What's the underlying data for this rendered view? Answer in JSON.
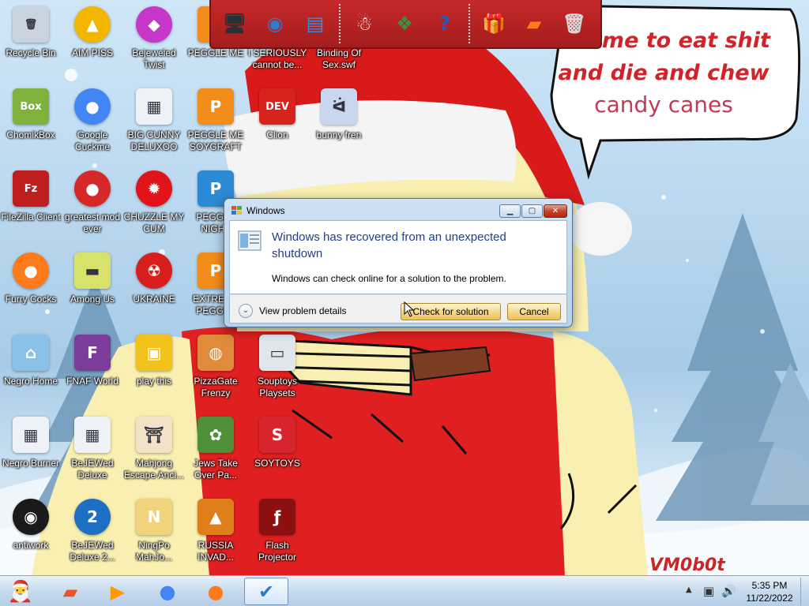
{
  "desktop_icons": [
    {
      "label": "Recycle Bin",
      "icon": "recycle-bin-icon",
      "color": "#c9d3de",
      "glyph": "🗑"
    },
    {
      "label": "AIM PISS",
      "icon": "aim-icon",
      "color": "#f2b600",
      "glyph": "▲"
    },
    {
      "label": "Bejeweled Twist",
      "icon": "bejeweled-icon",
      "color": "#c437c9",
      "glyph": "◆"
    },
    {
      "label": "PEGGLE ME",
      "icon": "peggle-icon",
      "color": "#f28c1b",
      "glyph": "P"
    },
    {
      "label": "I SERIOUSLY cannot be...",
      "icon": "globe-icon",
      "color": "#2a8fd6",
      "glyph": "◉"
    },
    {
      "label": "Binding Of Sex.swf",
      "icon": "swf-file-icon",
      "color": "#e8e8e8",
      "glyph": "▦"
    },
    {
      "label": "ChomikBox",
      "icon": "chomikbox-icon",
      "color": "#7fb23a",
      "glyph": "Box"
    },
    {
      "label": "Google Cuckme",
      "icon": "chrome-icon",
      "color": "#4285f4",
      "glyph": "●"
    },
    {
      "label": "BIG CUNNY DELUXOO",
      "icon": "document-icon",
      "color": "#eef2f7",
      "glyph": "▦"
    },
    {
      "label": "PEGGLE ME SOYGRAFT",
      "icon": "peggle-icon",
      "color": "#f28c1b",
      "glyph": "P"
    },
    {
      "label": "Clion",
      "icon": "devcpp-icon",
      "color": "#d8221c",
      "glyph": "DEV"
    },
    {
      "label": "bunny fren",
      "icon": "bunny-icon",
      "color": "#c8d6f0",
      "glyph": "ᐛ"
    },
    {
      "label": "FileZilla Client",
      "icon": "filezilla-icon",
      "color": "#bf1e1e",
      "glyph": "Fz"
    },
    {
      "label": "greatest mod ever",
      "icon": "angry-bird-icon",
      "color": "#d62828",
      "glyph": "●"
    },
    {
      "label": "CHUZZLE MY CUM",
      "icon": "chuzzle-icon",
      "color": "#e2141b",
      "glyph": "✹"
    },
    {
      "label": "PEGGLE NIGHT",
      "icon": "peggle-icon",
      "color": "#2d8ad4",
      "glyph": "P"
    },
    {
      "label": "Furry Cocks",
      "icon": "firefox-icon",
      "color": "#ff7a1a",
      "glyph": "●"
    },
    {
      "label": "Among Us",
      "icon": "among-us-icon",
      "color": "#d8e26a",
      "glyph": "▬"
    },
    {
      "label": "UKRAINE",
      "icon": "radiation-icon",
      "color": "#d91e1e",
      "glyph": "☢"
    },
    {
      "label": "EXTREME PEGGLE",
      "icon": "peggle-icon",
      "color": "#f28c1b",
      "glyph": "P"
    },
    {
      "label": "Negro Home",
      "icon": "home-icon",
      "color": "#8ac1e8",
      "glyph": "⌂"
    },
    {
      "label": "FNAF World",
      "icon": "fnaf-icon",
      "color": "#7b3c9c",
      "glyph": "F"
    },
    {
      "label": "play this",
      "icon": "mahjong-tile-icon",
      "color": "#f3c21a",
      "glyph": "▣"
    },
    {
      "label": "PizzaGate Frenzy",
      "icon": "pizza-icon",
      "color": "#e08a3c",
      "glyph": "◍"
    },
    {
      "label": "Souptoys Playsets",
      "icon": "window-icon",
      "color": "#dfe6ee",
      "glyph": "▭"
    },
    {
      "label": "Negro Burner",
      "icon": "document-icon",
      "color": "#eef2f7",
      "glyph": "▦"
    },
    {
      "label": "BeJEWed Deluxe",
      "icon": "document-icon",
      "color": "#eef2f7",
      "glyph": "▦"
    },
    {
      "label": "Mahjong Escape Anci...",
      "icon": "torii-icon",
      "color": "#f2e3c8",
      "glyph": "⛩"
    },
    {
      "label": "Jews Take Over Pa...",
      "icon": "plant-icon",
      "color": "#4f8f3a",
      "glyph": "✿"
    },
    {
      "label": "SOYTOYS",
      "icon": "soytoys-icon",
      "color": "#d8242c",
      "glyph": "S"
    },
    {
      "label": "antiwork",
      "icon": "antiwork-icon",
      "color": "#1a1a1a",
      "glyph": "◉"
    },
    {
      "label": "BeJEWed Deluxe 2...",
      "icon": "bejeweled-2-icon",
      "color": "#1d6fc4",
      "glyph": "2"
    },
    {
      "label": "NingPo MahJo...",
      "icon": "ningpo-icon",
      "color": "#f0d37a",
      "glyph": "N"
    },
    {
      "label": "RUSSIA INVAD...",
      "icon": "russia-icon",
      "color": "#e07f1a",
      "glyph": "▲"
    },
    {
      "label": "Flash Projector",
      "icon": "flash-icon",
      "color": "#8c1010",
      "glyph": "ƒ"
    }
  ],
  "toolbar": {
    "items": [
      {
        "name": "computer-icon",
        "glyph": "🖥",
        "color": "#263238"
      },
      {
        "name": "network-globe-icon",
        "glyph": "◉",
        "color": "#2e7bd1"
      },
      {
        "name": "control-panel-icon",
        "glyph": "▤",
        "color": "#3a8fd8"
      },
      {
        "name": "snowman-icon",
        "glyph": "☃",
        "color": "#ffffff"
      },
      {
        "name": "windows-logo-icon",
        "glyph": "❖",
        "color": "#2e9b3a"
      },
      {
        "name": "help-icon",
        "glyph": "?",
        "color": "#1c5fc4"
      },
      {
        "name": "gift-box-icon",
        "glyph": "🎁",
        "color": "#e6a600"
      },
      {
        "name": "folder-icon",
        "glyph": "▰",
        "color": "#ff7a1a"
      },
      {
        "name": "trash-icon",
        "glyph": "🗑",
        "color": "#d8d8d8"
      }
    ]
  },
  "speech_bubble": {
    "line1": "is time to eat shit",
    "line2": "and die and chew",
    "line3": "candy canes"
  },
  "signature": "VM0b0t",
  "dialog": {
    "title": "Windows",
    "heading": "Windows has recovered from an unexpected shutdown",
    "message": "Windows can check online for a solution to the problem.",
    "details_label": "View problem details",
    "check_label": "Check for solution",
    "cancel_label": "Cancel"
  },
  "taskbar": {
    "items": [
      {
        "name": "file-manager-icon",
        "glyph": "▰",
        "color": "#e8532b"
      },
      {
        "name": "media-player-icon",
        "glyph": "▶",
        "color": "#ff9800"
      },
      {
        "name": "chrome-taskbar-icon",
        "glyph": "●",
        "color": "#4285f4"
      },
      {
        "name": "firefox-taskbar-icon",
        "glyph": "●",
        "color": "#ff7a1a"
      },
      {
        "name": "problem-reports-icon",
        "glyph": "✔",
        "color": "#2a7bd4"
      }
    ],
    "clock_time": "5:35 PM",
    "clock_date": "11/22/2022"
  },
  "colors": {
    "toolbar_red": "#c62828",
    "dialog_heading": "#1f3f8a",
    "button_gold": "#ecc35a"
  }
}
